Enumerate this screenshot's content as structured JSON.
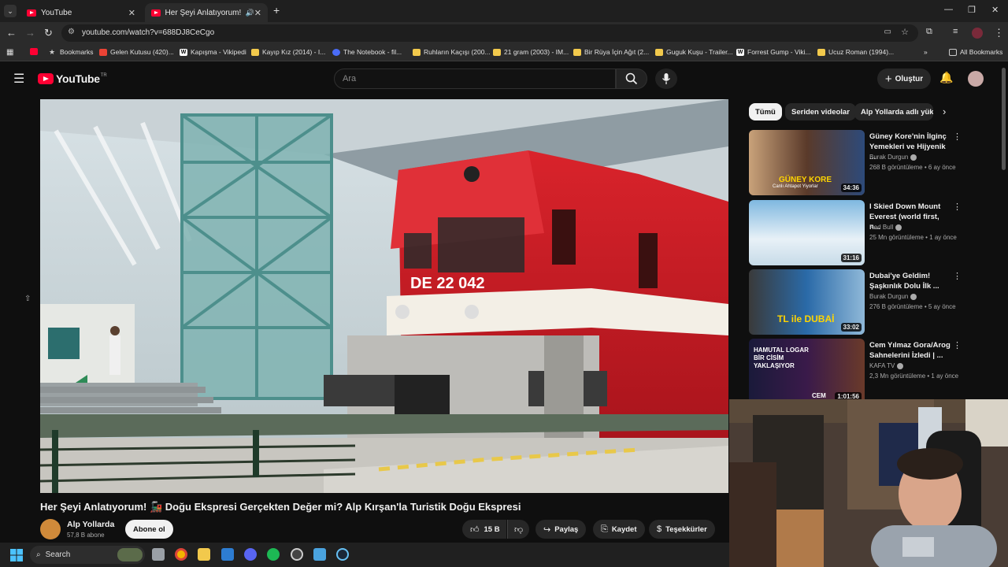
{
  "browser": {
    "tabs": [
      {
        "label": "YouTube"
      },
      {
        "label": "Her Şeyi Anlatıyorum! 🚂 D"
      }
    ],
    "url": "youtube.com/watch?v=688DJ8CeCgo",
    "bookmarks": [
      {
        "label": "Bookmarks",
        "icon": "star"
      },
      {
        "label": "Gelen Kutusu (420)...",
        "icon": "gmail"
      },
      {
        "label": "Kapışma - Vikipedi",
        "icon": "wiki"
      },
      {
        "label": "Kayıp Kız (2014) - I...",
        "icon": "folder"
      },
      {
        "label": "The Notebook - fil...",
        "icon": "blue"
      },
      {
        "label": "Ruhların Kaçışı (200...",
        "icon": "folder"
      },
      {
        "label": "21 gram (2003) - IM...",
        "icon": "folder"
      },
      {
        "label": "Bir Rüya İçin Ağıt (2...",
        "icon": "folder"
      },
      {
        "label": "Guguk Kuşu - Trailer...",
        "icon": "folder"
      },
      {
        "label": "Forrest Gump - Viki...",
        "icon": "wiki"
      },
      {
        "label": "Ucuz Roman (1994)...",
        "icon": "folder"
      }
    ],
    "all_bookmarks": "All Bookmarks"
  },
  "youtube": {
    "logo_text": "YouTube",
    "logo_region": "TR",
    "search_placeholder": "Ara",
    "create_label": "Oluştur"
  },
  "video": {
    "title": "Her Şeyi Anlatıyorum! 🚂 Doğu Ekspresi Gerçekten Değer mi? Alp Kırşan'la Turistik Doğu Ekspresi",
    "loco_number": "DE 22 042",
    "channel_name": "Alp Yollarda",
    "subscribers": "57,8 B abone",
    "subscribe_label": "Abone ol",
    "likes": "15 B",
    "share_label": "Paylaş",
    "save_label": "Kaydet",
    "thanks_label": "Teşekkürler"
  },
  "sidebar": {
    "chips": [
      "Tümü",
      "Seriden videolar",
      "Alp Yollarda adlı yükl"
    ],
    "recommendations": [
      {
        "title_1": "Güney Kore'nin İlginç",
        "title_2": "Yemekleri ve Hijyenik ...",
        "channel": "Burak Durgun",
        "meta": "268 B görüntüleme • 6 ay önce",
        "duration": "34:36",
        "thumb_text": "GÜNEY KORE",
        "thumb_sub": "Canlı Ahtapot Yiyorlar"
      },
      {
        "title_1": "I Skied Down Mount",
        "title_2": "Everest (world first, n...",
        "channel": "Red Bull",
        "meta": "25 Mn görüntüleme • 1 ay önce",
        "duration": "31:16",
        "thumb_text": "",
        "thumb_sub": ""
      },
      {
        "title_1": "Dubai'ye Geldim!",
        "title_2": "Şaşkınlık Dolu İlk ...",
        "channel": "Burak Durgun",
        "meta": "276 B görüntüleme • 5 ay önce",
        "duration": "33:02",
        "thumb_text": "TL ile DUBAİ",
        "thumb_sub": ""
      },
      {
        "title_1": "Cem Yılmaz Gora/Arog",
        "title_2": "Sahnelerini İzledi | ...",
        "channel": "KAFA TV",
        "meta": "2,3 Mn görüntüleme • 1 ay önce",
        "duration": "1:01:56",
        "thumb_text": "HAMUTAL LOGAR BİR CİSİM YAKLAŞIYOR",
        "thumb_sub": "CEM"
      }
    ]
  },
  "taskbar": {
    "search_label": "Search"
  },
  "colors": {
    "yt_red": "#ff0033",
    "bg": "#0f0f0f",
    "chip": "#272727"
  }
}
